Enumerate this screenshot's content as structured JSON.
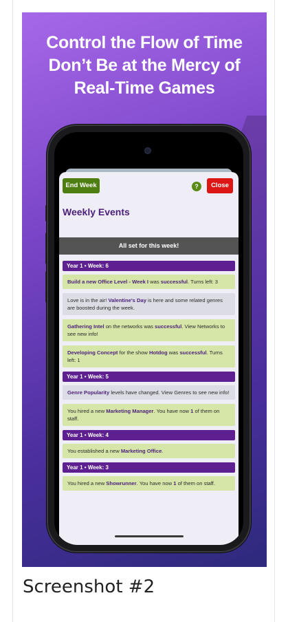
{
  "promo": {
    "headline_line1": "Control the Flow of Time",
    "headline_line2": "Don’t Be at the Mercy of",
    "headline_line3": "Real-Time Games"
  },
  "toolbar": {
    "end_week_label": "End Week",
    "help_label": "?",
    "close_label": "Close"
  },
  "page": {
    "title": "Weekly Events",
    "status_banner": "All set for this week!"
  },
  "weeks": [
    {
      "header": "Year 1 • Week: 6",
      "events": [
        {
          "style": "green",
          "parts": [
            {
              "t": "Build a new Office Level - Week I",
              "b": true
            },
            {
              "t": " was "
            },
            {
              "t": "successful",
              "b": true
            },
            {
              "t": ". Turns left: 3"
            }
          ]
        },
        {
          "style": "grey",
          "parts": [
            {
              "t": "Love is in the air! "
            },
            {
              "t": "Valentine's Day",
              "b": true
            },
            {
              "t": " is here and some related genres are boosted during the week."
            }
          ]
        },
        {
          "style": "green",
          "parts": [
            {
              "t": "Gathering Intel",
              "b": true
            },
            {
              "t": " on the networks was "
            },
            {
              "t": "successful",
              "b": true
            },
            {
              "t": ". View Networks to see new info!"
            }
          ]
        },
        {
          "style": "green",
          "parts": [
            {
              "t": "Developing Concept",
              "b": true
            },
            {
              "t": " for the show "
            },
            {
              "t": "Hotdog",
              "b": true
            },
            {
              "t": " was "
            },
            {
              "t": "successful",
              "b": true
            },
            {
              "t": ". Turns left: 1"
            }
          ]
        }
      ]
    },
    {
      "header": "Year 1 • Week: 5",
      "events": [
        {
          "style": "grey",
          "parts": [
            {
              "t": "Genre Popularity",
              "b": true
            },
            {
              "t": " levels have changed. View Genres to see new info!"
            }
          ]
        },
        {
          "style": "green",
          "parts": [
            {
              "t": "You hired a new "
            },
            {
              "t": "Marketing Manager",
              "b": true
            },
            {
              "t": ". You have now "
            },
            {
              "t": "1",
              "b": true
            },
            {
              "t": " of them on staff."
            }
          ]
        }
      ]
    },
    {
      "header": "Year 1 • Week: 4",
      "events": [
        {
          "style": "green",
          "parts": [
            {
              "t": "You established a new "
            },
            {
              "t": "Marketing Office",
              "b": true
            },
            {
              "t": "."
            }
          ]
        }
      ]
    },
    {
      "header": "Year 1 • Week: 3",
      "events": [
        {
          "style": "green",
          "parts": [
            {
              "t": "You hired a new "
            },
            {
              "t": "Showrunner",
              "b": true
            },
            {
              "t": ". You have now "
            },
            {
              "t": "1",
              "b": true
            },
            {
              "t": " of them on staff."
            }
          ]
        }
      ]
    }
  ],
  "caption": "Screenshot #2",
  "colors": {
    "accent_purple": "#5e1f91",
    "end_week_green": "#4e7d12",
    "close_red": "#dc1515",
    "event_green": "#d6e6a8",
    "event_grey": "#dcdce4",
    "status_grey": "#545454"
  }
}
